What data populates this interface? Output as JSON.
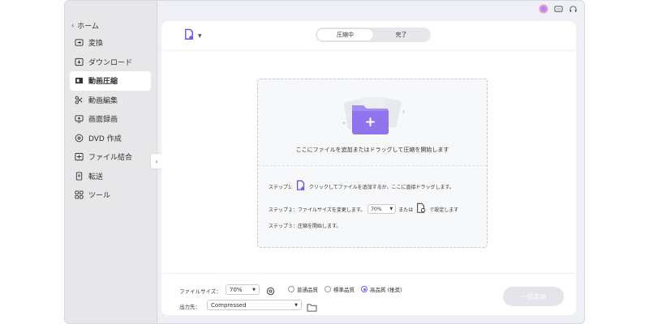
{
  "window": {
    "traffic_colors": [
      "#ff5f57",
      "#febc2e",
      "#28c840"
    ]
  },
  "sidebar": {
    "home_label": "ホーム",
    "items": [
      {
        "label": "変換",
        "icon": "convert-icon",
        "active": false
      },
      {
        "label": "ダウンロード",
        "icon": "download-icon",
        "active": false
      },
      {
        "label": "動画圧縮",
        "icon": "compress-icon",
        "active": true
      },
      {
        "label": "動画編集",
        "icon": "scissors-icon",
        "active": false
      },
      {
        "label": "画面録画",
        "icon": "screen-record-icon",
        "active": false
      },
      {
        "label": "DVD 作成",
        "icon": "dvd-icon",
        "active": false
      },
      {
        "label": "ファイル結合",
        "icon": "merge-icon",
        "active": false
      },
      {
        "label": "転送",
        "icon": "transfer-icon",
        "active": false
      },
      {
        "label": "ツール",
        "icon": "toolbox-icon",
        "active": false
      }
    ]
  },
  "topbar": {
    "icons": [
      "user-avatar-icon",
      "message-icon",
      "headset-icon"
    ]
  },
  "main": {
    "tabs": [
      {
        "label": "圧縮中",
        "active": true
      },
      {
        "label": "完了",
        "active": false
      }
    ],
    "dropzone": {
      "text": "ここにファイルを追加またはドラッグして圧縮を開始します"
    },
    "steps": {
      "step1_label": "ステップ1:",
      "step1_text": "クリックしてファイルを追加するか、ここに直接ドラッグします。",
      "step2_label": "ステップ２：ファイルサイズを変更します。",
      "step2_value": "70%",
      "step2_or": "または",
      "step2_suffix": "で設定します",
      "step3_label": "ステップ３：圧縮を開始します。"
    }
  },
  "bottom": {
    "filesize_label": "ファイルサイズ：",
    "filesize_value": "70%",
    "quality_options": [
      {
        "label": "普通品質",
        "checked": false
      },
      {
        "label": "標準品質",
        "checked": false
      },
      {
        "label": "高品質 (推奨)",
        "checked": true
      }
    ],
    "output_label": "出力先：",
    "output_value": "Compressed",
    "convert_button": "一括変換"
  },
  "colors": {
    "accent": "#7a5cf0",
    "sidebar_bg": "#e7e7ea",
    "button_disabled": "#e4e5ea"
  }
}
